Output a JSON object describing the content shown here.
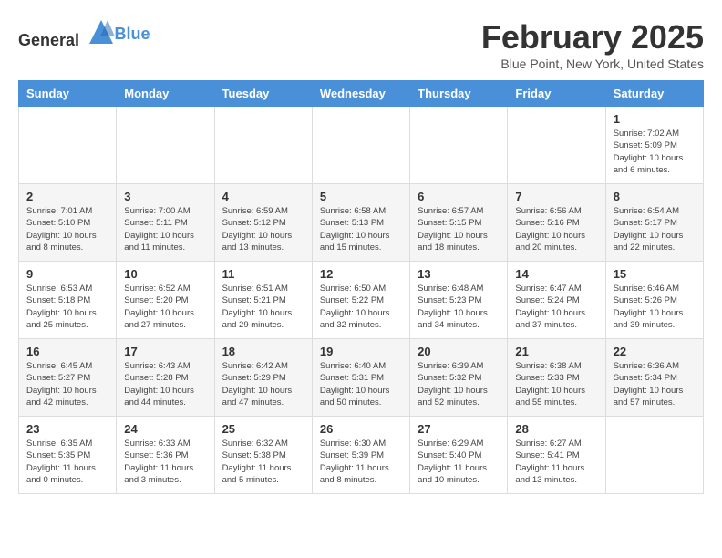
{
  "header": {
    "logo_general": "General",
    "logo_blue": "Blue",
    "title": "February 2025",
    "subtitle": "Blue Point, New York, United States"
  },
  "weekdays": [
    "Sunday",
    "Monday",
    "Tuesday",
    "Wednesday",
    "Thursday",
    "Friday",
    "Saturday"
  ],
  "weeks": [
    [
      {
        "day": "",
        "info": ""
      },
      {
        "day": "",
        "info": ""
      },
      {
        "day": "",
        "info": ""
      },
      {
        "day": "",
        "info": ""
      },
      {
        "day": "",
        "info": ""
      },
      {
        "day": "",
        "info": ""
      },
      {
        "day": "1",
        "info": "Sunrise: 7:02 AM\nSunset: 5:09 PM\nDaylight: 10 hours\nand 6 minutes."
      }
    ],
    [
      {
        "day": "2",
        "info": "Sunrise: 7:01 AM\nSunset: 5:10 PM\nDaylight: 10 hours\nand 8 minutes."
      },
      {
        "day": "3",
        "info": "Sunrise: 7:00 AM\nSunset: 5:11 PM\nDaylight: 10 hours\nand 11 minutes."
      },
      {
        "day": "4",
        "info": "Sunrise: 6:59 AM\nSunset: 5:12 PM\nDaylight: 10 hours\nand 13 minutes."
      },
      {
        "day": "5",
        "info": "Sunrise: 6:58 AM\nSunset: 5:13 PM\nDaylight: 10 hours\nand 15 minutes."
      },
      {
        "day": "6",
        "info": "Sunrise: 6:57 AM\nSunset: 5:15 PM\nDaylight: 10 hours\nand 18 minutes."
      },
      {
        "day": "7",
        "info": "Sunrise: 6:56 AM\nSunset: 5:16 PM\nDaylight: 10 hours\nand 20 minutes."
      },
      {
        "day": "8",
        "info": "Sunrise: 6:54 AM\nSunset: 5:17 PM\nDaylight: 10 hours\nand 22 minutes."
      }
    ],
    [
      {
        "day": "9",
        "info": "Sunrise: 6:53 AM\nSunset: 5:18 PM\nDaylight: 10 hours\nand 25 minutes."
      },
      {
        "day": "10",
        "info": "Sunrise: 6:52 AM\nSunset: 5:20 PM\nDaylight: 10 hours\nand 27 minutes."
      },
      {
        "day": "11",
        "info": "Sunrise: 6:51 AM\nSunset: 5:21 PM\nDaylight: 10 hours\nand 29 minutes."
      },
      {
        "day": "12",
        "info": "Sunrise: 6:50 AM\nSunset: 5:22 PM\nDaylight: 10 hours\nand 32 minutes."
      },
      {
        "day": "13",
        "info": "Sunrise: 6:48 AM\nSunset: 5:23 PM\nDaylight: 10 hours\nand 34 minutes."
      },
      {
        "day": "14",
        "info": "Sunrise: 6:47 AM\nSunset: 5:24 PM\nDaylight: 10 hours\nand 37 minutes."
      },
      {
        "day": "15",
        "info": "Sunrise: 6:46 AM\nSunset: 5:26 PM\nDaylight: 10 hours\nand 39 minutes."
      }
    ],
    [
      {
        "day": "16",
        "info": "Sunrise: 6:45 AM\nSunset: 5:27 PM\nDaylight: 10 hours\nand 42 minutes."
      },
      {
        "day": "17",
        "info": "Sunrise: 6:43 AM\nSunset: 5:28 PM\nDaylight: 10 hours\nand 44 minutes."
      },
      {
        "day": "18",
        "info": "Sunrise: 6:42 AM\nSunset: 5:29 PM\nDaylight: 10 hours\nand 47 minutes."
      },
      {
        "day": "19",
        "info": "Sunrise: 6:40 AM\nSunset: 5:31 PM\nDaylight: 10 hours\nand 50 minutes."
      },
      {
        "day": "20",
        "info": "Sunrise: 6:39 AM\nSunset: 5:32 PM\nDaylight: 10 hours\nand 52 minutes."
      },
      {
        "day": "21",
        "info": "Sunrise: 6:38 AM\nSunset: 5:33 PM\nDaylight: 10 hours\nand 55 minutes."
      },
      {
        "day": "22",
        "info": "Sunrise: 6:36 AM\nSunset: 5:34 PM\nDaylight: 10 hours\nand 57 minutes."
      }
    ],
    [
      {
        "day": "23",
        "info": "Sunrise: 6:35 AM\nSunset: 5:35 PM\nDaylight: 11 hours\nand 0 minutes."
      },
      {
        "day": "24",
        "info": "Sunrise: 6:33 AM\nSunset: 5:36 PM\nDaylight: 11 hours\nand 3 minutes."
      },
      {
        "day": "25",
        "info": "Sunrise: 6:32 AM\nSunset: 5:38 PM\nDaylight: 11 hours\nand 5 minutes."
      },
      {
        "day": "26",
        "info": "Sunrise: 6:30 AM\nSunset: 5:39 PM\nDaylight: 11 hours\nand 8 minutes."
      },
      {
        "day": "27",
        "info": "Sunrise: 6:29 AM\nSunset: 5:40 PM\nDaylight: 11 hours\nand 10 minutes."
      },
      {
        "day": "28",
        "info": "Sunrise: 6:27 AM\nSunset: 5:41 PM\nDaylight: 11 hours\nand 13 minutes."
      },
      {
        "day": "",
        "info": ""
      }
    ]
  ]
}
